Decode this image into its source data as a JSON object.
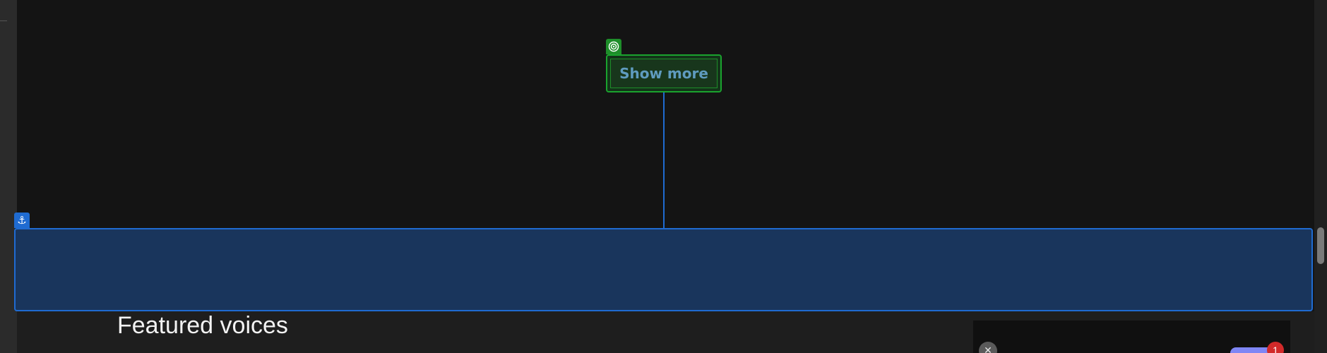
{
  "show_more": {
    "label": "Show more"
  },
  "section": {
    "title": "Featured voices"
  },
  "notification": {
    "count": "1"
  },
  "icons": {
    "target": "target-icon",
    "anchor": "anchor-icon",
    "close": "close-icon",
    "anchor_glyph": "⚓",
    "close_glyph": "✕"
  },
  "colors": {
    "background": "#141414",
    "highlight_green": "#1aa32e",
    "highlight_blue": "#1f6bd1",
    "anchor_fill": "#19355c",
    "button_text": "#5f9bbf",
    "badge_red": "#d22a2a",
    "pill_purple": "#7f86f5"
  }
}
